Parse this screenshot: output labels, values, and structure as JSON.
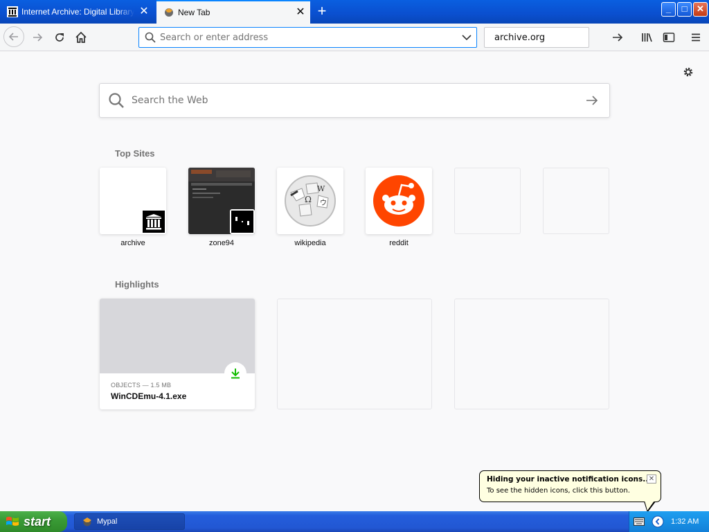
{
  "tabs": [
    {
      "label": "Internet Archive: Digital Library of",
      "active": false
    },
    {
      "label": "New Tab",
      "active": true
    }
  ],
  "window_controls": {
    "minimize": "_",
    "maximize": "□",
    "close": "✕"
  },
  "navbar": {
    "url_placeholder": "Search or enter address",
    "search_value": "archive.org"
  },
  "newtab": {
    "web_search_placeholder": "Search the Web",
    "top_sites_title": "Top Sites",
    "top_sites": [
      {
        "label": "archive"
      },
      {
        "label": "zone94"
      },
      {
        "label": "wikipedia"
      },
      {
        "label": "reddit"
      },
      {
        "label": ""
      },
      {
        "label": ""
      }
    ],
    "highlights_title": "Highlights",
    "highlights": [
      {
        "meta": "OBJECTS — 1.5 MB",
        "title": "WinCDEmu-4.1.exe"
      }
    ]
  },
  "notification": {
    "title": "Hiding your inactive notification icons...",
    "text": "To see the hidden icons, click this button.",
    "close": "✕"
  },
  "taskbar": {
    "start_label": "start",
    "task_label": "Mypal",
    "clock": "1:32 AM"
  },
  "colors": {
    "accent": "#0a84ff",
    "reddit": "#ff4500",
    "download_green": "#12bc00",
    "xp_blue": "#245edc",
    "xp_green": "#3a9b36"
  }
}
